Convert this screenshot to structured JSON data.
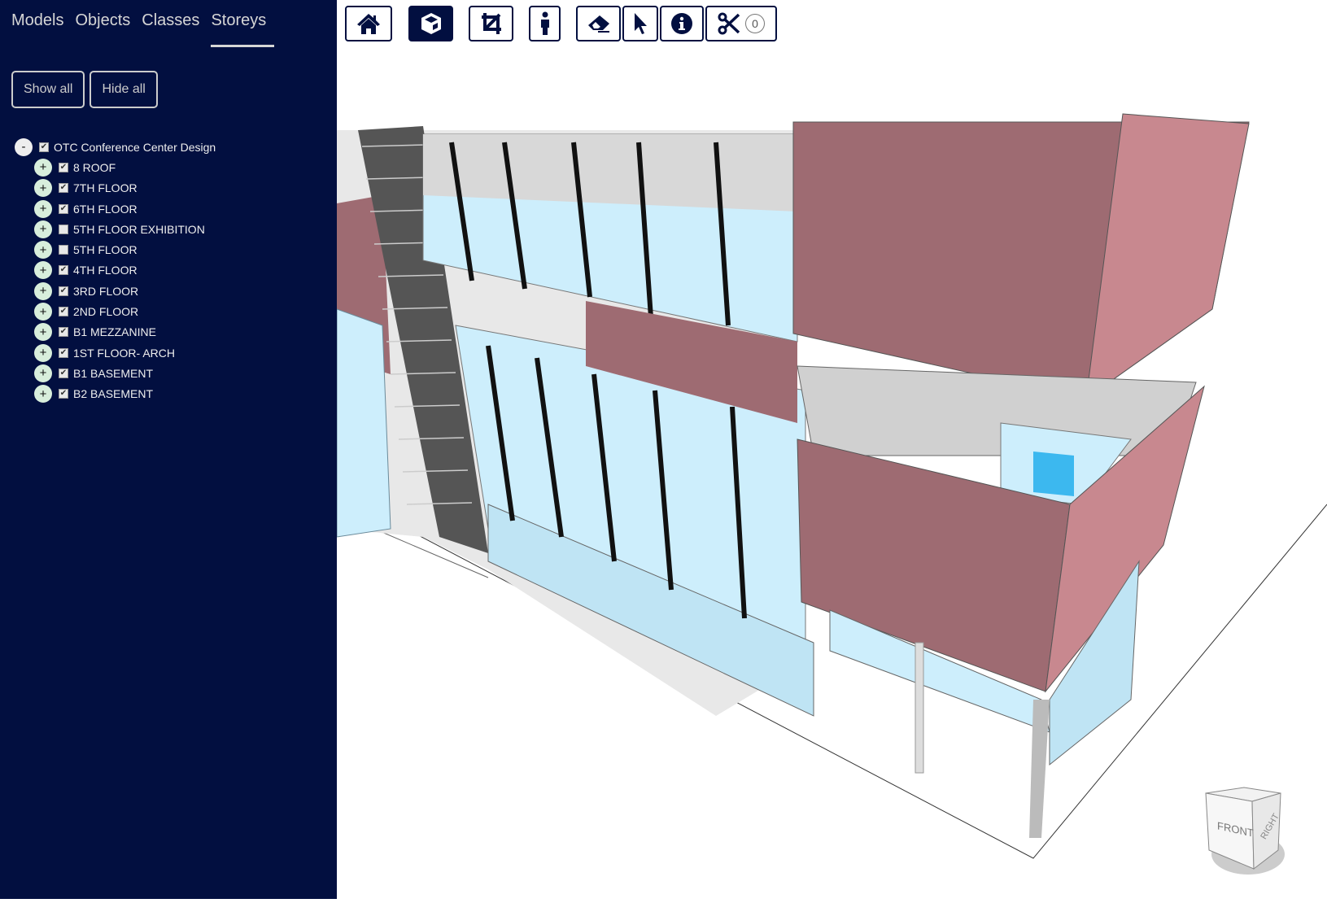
{
  "sidebar": {
    "tabs": [
      {
        "label": "Models"
      },
      {
        "label": "Objects"
      },
      {
        "label": "Classes"
      },
      {
        "label": "Storeys",
        "active": true
      }
    ],
    "show_all": "Show all",
    "hide_all": "Hide all",
    "tree": {
      "root": {
        "toggle": "-",
        "label": "OTC Conference Center Design",
        "checked": true
      },
      "children": [
        {
          "label": "8 ROOF",
          "checked": true
        },
        {
          "label": "7TH FLOOR",
          "checked": true
        },
        {
          "label": "6TH FLOOR",
          "checked": true
        },
        {
          "label": "5TH FLOOR EXHIBITION",
          "checked": false
        },
        {
          "label": "5TH FLOOR",
          "checked": false
        },
        {
          "label": "4TH FLOOR",
          "checked": true
        },
        {
          "label": "3RD FLOOR",
          "checked": true
        },
        {
          "label": "2ND FLOOR",
          "checked": true
        },
        {
          "label": "B1 MEZZANINE",
          "checked": true
        },
        {
          "label": "1ST FLOOR- ARCH",
          "checked": true
        },
        {
          "label": "B1 BASEMENT",
          "checked": true
        },
        {
          "label": "B2 BASEMENT",
          "checked": true
        }
      ],
      "child_toggle": "+"
    }
  },
  "toolbar": {
    "tools": [
      "home-icon",
      "cube-icon",
      "crop-icon",
      "person-icon",
      "eraser-icon",
      "pointer-icon",
      "info-icon",
      "scissors-icon"
    ],
    "active": "cube-icon",
    "section_count": "0"
  },
  "navcube": {
    "front": "FRONT",
    "right": "RIGHT"
  },
  "colors": {
    "sidebar": "#020f40",
    "facade": "#9e6b72",
    "glass": "#cdeefc"
  }
}
